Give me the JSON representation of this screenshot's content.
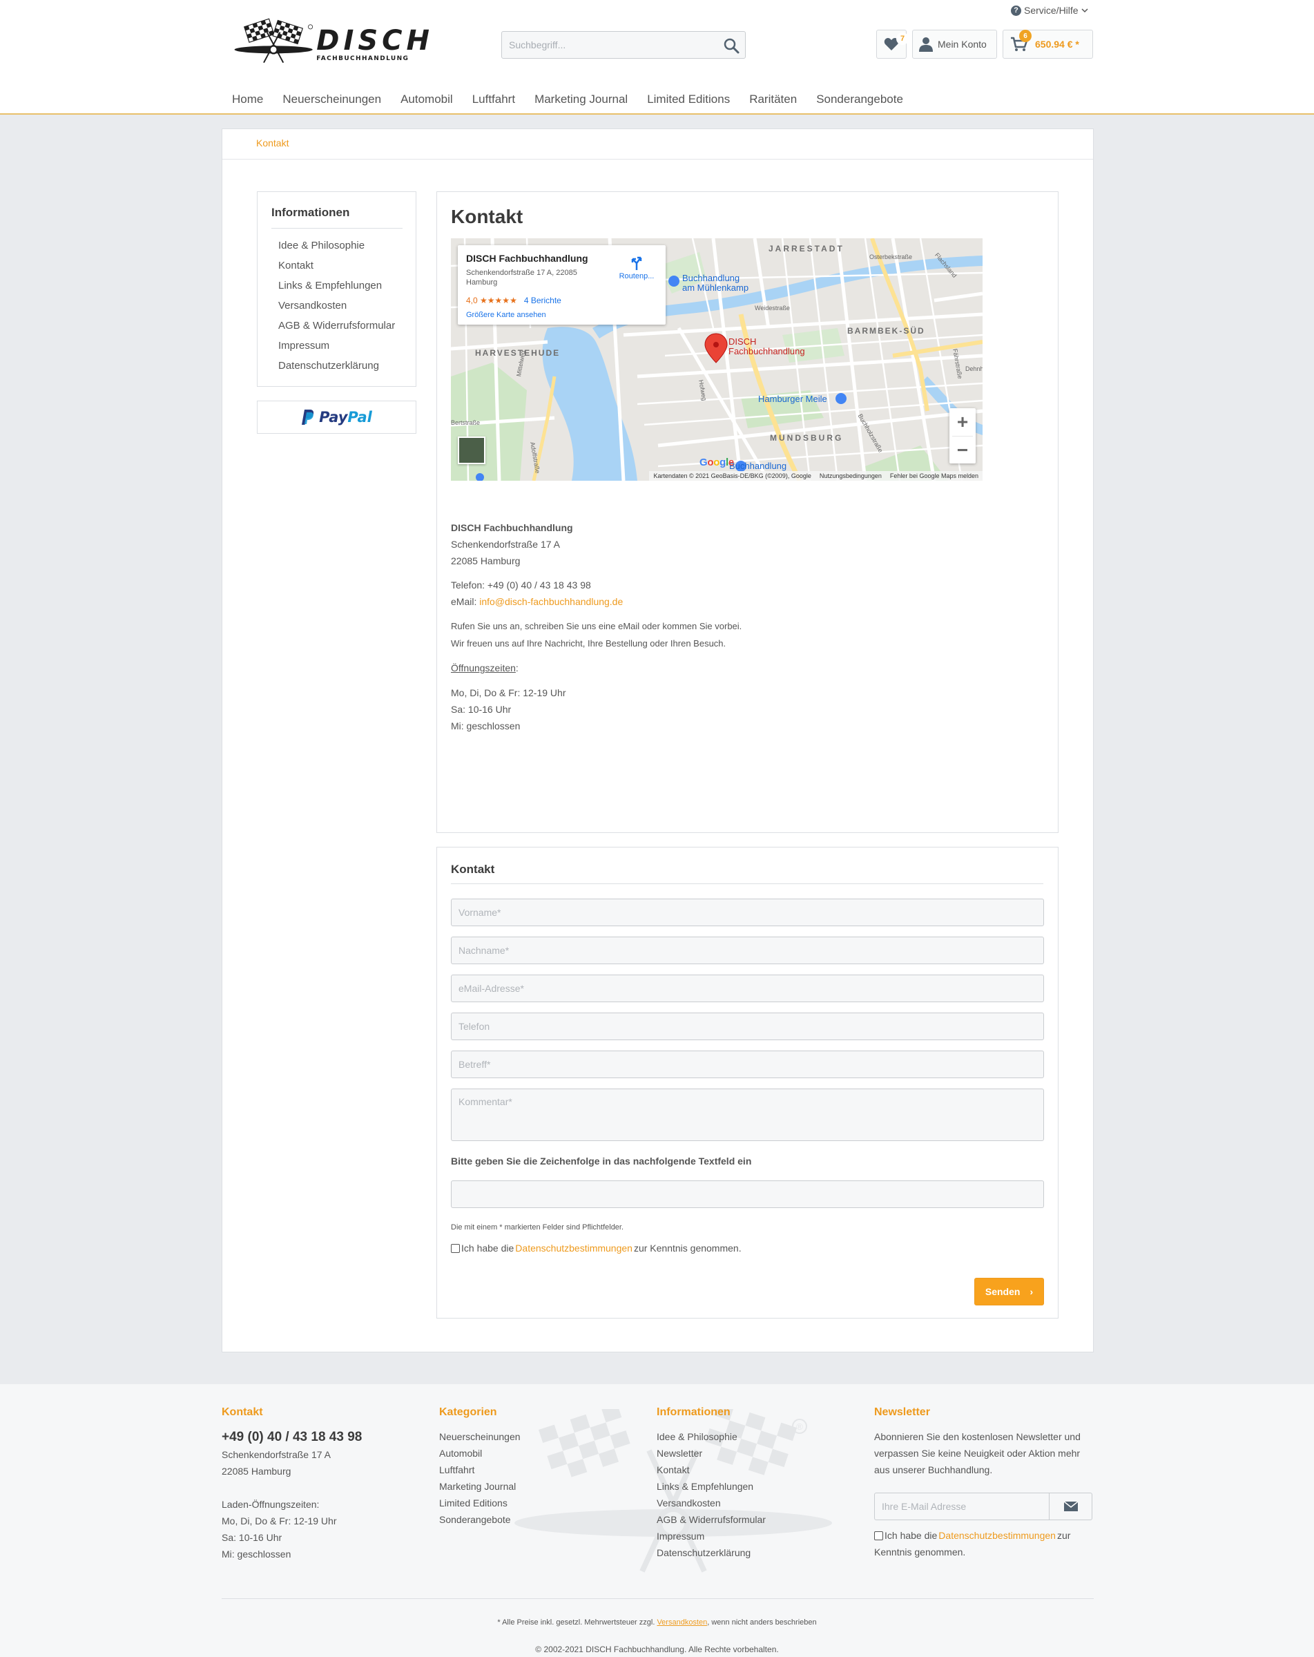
{
  "header": {
    "service_label": "Service/Hilfe",
    "brand": "DISCH",
    "brand_sub": "FACHBUCHHANDLUNG",
    "search_placeholder": "Suchbegriff...",
    "wishlist_count": "7",
    "account_label": "Mein Konto",
    "cart_count": "6",
    "cart_price": "650.94 € *"
  },
  "nav": {
    "items": [
      "Home",
      "Neuerscheinungen",
      "Automobil",
      "Luftfahrt",
      "Marketing Journal",
      "Limited Editions",
      "Raritäten",
      "Sonderangebote"
    ]
  },
  "breadcrumb": "Kontakt",
  "sidebar": {
    "title": "Informationen",
    "items": [
      "Idee & Philosophie",
      "Kontakt",
      "Links & Empfehlungen",
      "Versandkosten",
      "AGB & Widerrufsformular",
      "Impressum",
      "Datenschutzerklärung"
    ]
  },
  "payment": {
    "paypal_pay": "Pay",
    "paypal_pal": "Pal"
  },
  "content": {
    "title": "Kontakt",
    "map": {
      "place_name": "DISCH Fachbuchhandlung",
      "place_address": "Schenkendorfstraße 17 A, 22085 Hamburg",
      "rating": "4,0",
      "stars": "★★★★★",
      "reviews": "4 Berichte",
      "larger_map": "Größere Karte ansehen",
      "route": "Routenp...",
      "labels": {
        "jarrestadt": "JARRESTADT",
        "barmbek": "BARMBEK-SÜD",
        "harvestehude": "HARVESTEHUDE",
        "mundsburg": "MUNDSBURG",
        "pin1": "DISCH",
        "pin2": "Fachbuchhandlung",
        "poi1a": "Buchhandlung",
        "poi1b": "am Mühlenkamp",
        "poi2": "Hamburger Meile",
        "poi3": "Buchhandlung",
        "street1": "Osterbekstraße",
        "street2": "Weidestraße",
        "street3": "Flachsland",
        "street4": "Mittelweg",
        "street5": "Hofweg",
        "street6": "Buchholzstraße",
        "street7": "Bertstraße",
        "street8": "Fährstraße",
        "street9": "Dehnhaide",
        "street10": "Adolfstraße"
      },
      "google": "Google",
      "attribution_1": "Kartendaten © 2021 GeoBasis-DE/BKG (©2009), Google",
      "attribution_2": "Nutzungsbedingungen",
      "attribution_3": "Fehler bei Google Maps melden"
    },
    "company": "DISCH Fachbuchhandlung",
    "street": "Schenkendorfstraße 17 A",
    "city": "22085 Hamburg",
    "phone": "Telefon: +49 (0) 40 / 43 18 43 98",
    "email_label": "eMail: ",
    "email": "info@disch-fachbuchhandlung.de",
    "intro1": "Rufen Sie uns an, schreiben Sie uns eine eMail oder kommen Sie vorbei.",
    "intro2": "Wir freuen uns auf Ihre Nachricht, Ihre Bestellung oder Ihren Besuch.",
    "hours_title": "Öffnungszeiten",
    "hours_colon": ":",
    "hours1": "Mo, Di, Do & Fr: 12-19 Uhr",
    "hours2": "Sa: 10-16 Uhr",
    "hours3": "Mi: geschlossen"
  },
  "form": {
    "title": "Kontakt",
    "first_name": "Vorname*",
    "last_name": "Nachname*",
    "email": "eMail-Adresse*",
    "phone": "Telefon",
    "subject": "Betreff*",
    "comment": "Kommentar*",
    "captcha_label": "Bitte geben Sie die Zeichenfolge in das nachfolgende Textfeld ein",
    "required_note": "Die mit einem * markierten Felder sind Pflichtfelder.",
    "privacy_pre": "Ich habe die ",
    "privacy_link": "Datenschutzbestimmungen",
    "privacy_post": " zur Kenntnis genommen.",
    "send": "Senden",
    "send_arrow": "›"
  },
  "footer": {
    "contact_title": "Kontakt",
    "phone": "+49 (0) 40 / 43 18 43 98",
    "street": "Schenkendorfstraße 17 A",
    "city": "22085 Hamburg",
    "hours_title": "Laden-Öffnungszeiten:",
    "hours1": "Mo, Di, Do & Fr: 12-19 Uhr",
    "hours2": "Sa: 10-16 Uhr",
    "hours3": "Mi: geschlossen",
    "categories_title": "Kategorien",
    "categories": [
      "Neuerscheinungen",
      "Automobil",
      "Luftfahrt",
      "Marketing Journal",
      "Limited Editions",
      "Sonderangebote"
    ],
    "info_title": "Informationen",
    "info": [
      "Idee & Philosophie",
      "Newsletter",
      "Kontakt",
      "Links & Empfehlungen",
      "Versandkosten",
      "AGB & Widerrufsformular",
      "Impressum",
      "Datenschutzerklärung"
    ],
    "newsletter_title": "Newsletter",
    "newsletter_text1": "Abonnieren Sie den kostenlosen Newsletter und",
    "newsletter_text2": "verpassen Sie keine Neuigkeit oder Aktion mehr",
    "newsletter_text3": "aus unserer Buchhandlung.",
    "newsletter_placeholder": "Ihre E-Mail Adresse",
    "nl_privacy_pre": "Ich habe die ",
    "nl_privacy_link": "Datenschutzbestimmungen",
    "nl_privacy_post": " zur",
    "nl_privacy_line2": "Kenntnis genommen.",
    "registered": "®",
    "vat_pre": "* Alle Preise inkl. gesetzl. Mehrwertsteuer zzgl. ",
    "vat_link": "Versandkosten",
    "vat_post": ", wenn nicht anders beschrieben",
    "copyright": "© 2002-2021 DISCH Fachbuchhandlung. Alle Rechte vorbehalten."
  },
  "colors": {
    "accent": "#ee9a1d",
    "button": "#f8a21d",
    "text": "#555555",
    "heading": "#3b3b3b"
  }
}
